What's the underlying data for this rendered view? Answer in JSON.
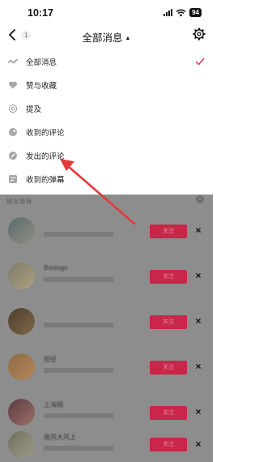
{
  "status_bar": {
    "time": "10:17",
    "battery": "94"
  },
  "header": {
    "back_count": "1",
    "title": "全部消息"
  },
  "menu": {
    "items": [
      {
        "label": "全部消息",
        "icon": "wave-icon",
        "selected": true
      },
      {
        "label": "赞与收藏",
        "icon": "heart-icon",
        "selected": false
      },
      {
        "label": "提及",
        "icon": "at-icon",
        "selected": false
      },
      {
        "label": "收到的评论",
        "icon": "comment-in-icon",
        "selected": false
      },
      {
        "label": "发出的评论",
        "icon": "comment-out-icon",
        "selected": false
      },
      {
        "label": "收到的弹幕",
        "icon": "danmaku-icon",
        "selected": false
      }
    ]
  },
  "recommend": {
    "header": "朋友推荐",
    "rows": [
      {
        "name": "",
        "follow_label": "关注"
      },
      {
        "name": "Boologo",
        "follow_label": "关注"
      },
      {
        "name": "",
        "follow_label": "关注"
      },
      {
        "name": "田径",
        "follow_label": "关注"
      },
      {
        "name": "上海网",
        "follow_label": "关注"
      },
      {
        "name": "南风大风上",
        "follow_label": "关注"
      }
    ]
  },
  "colors": {
    "accent": "#e8354f",
    "overlay": "#8d8d8d",
    "follow": "#c9264a"
  }
}
